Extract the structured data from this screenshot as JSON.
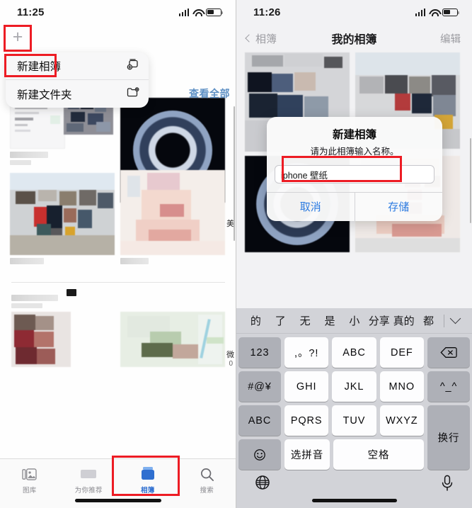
{
  "left_phone": {
    "status_bar": {
      "time": "11:25",
      "signal_icon": "cellular-signal-icon",
      "wifi_icon": "wifi-icon",
      "battery_icon": "battery-icon"
    },
    "add_button": {
      "label": "+",
      "icon": "plus-icon"
    },
    "context_menu": {
      "items": [
        {
          "label": "新建相簿",
          "icon": "new-album-icon"
        },
        {
          "label": "新建文件夹",
          "icon": "new-folder-icon"
        }
      ]
    },
    "see_all_label": "查看全部",
    "edge_labels": {
      "top": "美",
      "bottom": "微",
      "bottom_sub": "0"
    },
    "tab_bar": {
      "items": [
        {
          "label": "图库",
          "icon": "photos-library-icon",
          "active": false
        },
        {
          "label": "为你推荐",
          "icon": "for-you-icon",
          "active": false
        },
        {
          "label": "相簿",
          "icon": "albums-icon",
          "active": true
        },
        {
          "label": "搜索",
          "icon": "search-icon",
          "active": false
        }
      ]
    }
  },
  "right_phone": {
    "status_bar": {
      "time": "11:26",
      "signal_icon": "cellular-signal-icon",
      "wifi_icon": "wifi-icon",
      "battery_icon": "battery-icon"
    },
    "nav_bar": {
      "back_label": "相簿",
      "back_icon": "chevron-left-icon",
      "title": "我的相簿",
      "edit_label": "编辑"
    },
    "alert": {
      "title": "新建相簿",
      "message": "请为此相簿输入名称。",
      "input_value": "iphone 壁纸",
      "input_placeholder": "",
      "cancel_label": "取消",
      "save_label": "存储"
    },
    "keyboard": {
      "suggestions": [
        "的",
        "了",
        "无",
        "是",
        "小",
        "分享",
        "真的",
        "都"
      ],
      "collapse_icon": "chevron-down-icon",
      "rows": [
        [
          {
            "label": "123",
            "style": "dark"
          },
          {
            "label": ",。?!",
            "style": "light"
          },
          {
            "label": "ABC",
            "style": "light"
          },
          {
            "label": "DEF",
            "style": "light"
          },
          {
            "label": "",
            "style": "dark",
            "icon": "backspace-icon"
          }
        ],
        [
          {
            "label": "#@¥",
            "style": "dark"
          },
          {
            "label": "GHI",
            "style": "light"
          },
          {
            "label": "JKL",
            "style": "light"
          },
          {
            "label": "MNO",
            "style": "light"
          },
          {
            "label": "^_^",
            "style": "dark"
          }
        ],
        [
          {
            "label": "ABC",
            "style": "dark"
          },
          {
            "label": "PQRS",
            "style": "light"
          },
          {
            "label": "TUV",
            "style": "light"
          },
          {
            "label": "WXYZ",
            "style": "light"
          },
          {
            "label": "换行",
            "style": "dark"
          }
        ],
        [
          {
            "label": "",
            "style": "dark",
            "icon": "emoji-icon"
          },
          {
            "label": "选拼音",
            "style": "light"
          },
          {
            "label": "空格",
            "style": "light"
          }
        ]
      ],
      "globe_icon": "globe-icon",
      "mic_icon": "microphone-icon"
    }
  },
  "annotations": {
    "accent_color": "#ed1c24",
    "boxes": [
      {
        "name": "plus-button-highlight"
      },
      {
        "name": "new-album-menu-item-highlight"
      },
      {
        "name": "albums-tab-highlight"
      },
      {
        "name": "album-name-input-highlight"
      }
    ]
  }
}
